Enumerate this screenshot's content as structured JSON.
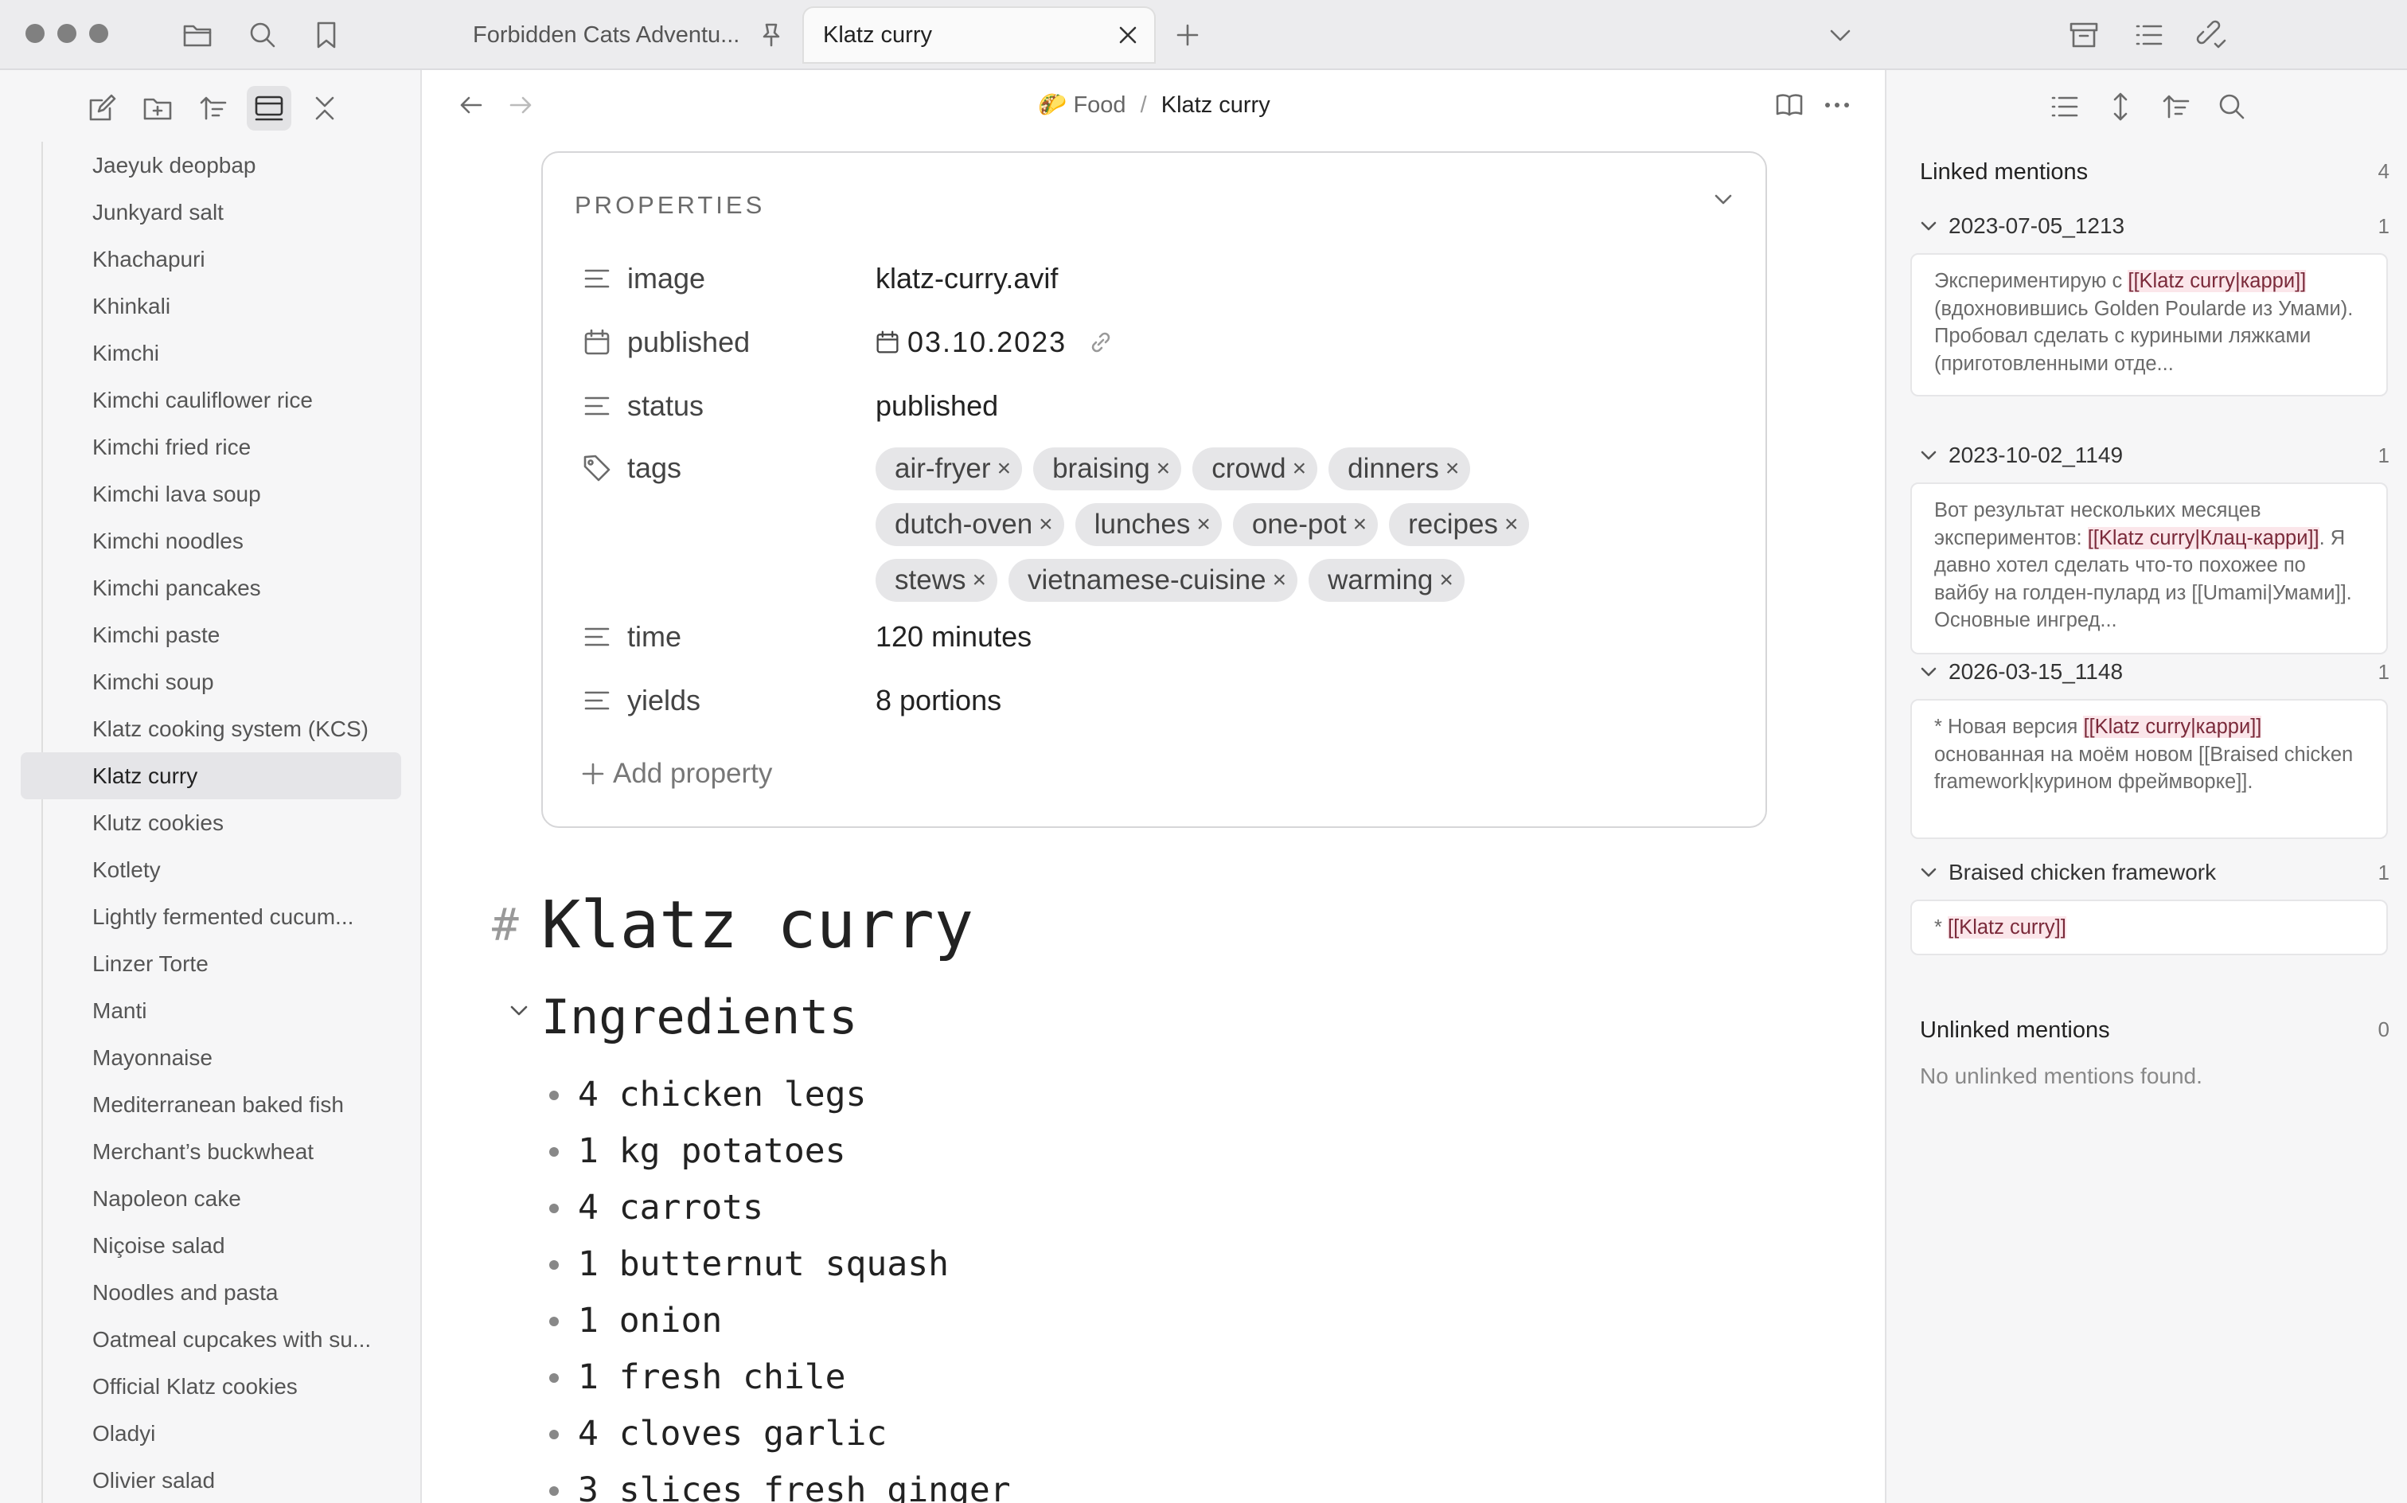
{
  "tabs": [
    {
      "label": "Forbidden Cats Adventu...",
      "active": false
    },
    {
      "label": "Klatz curry",
      "active": true
    }
  ],
  "sidebar": {
    "items": [
      "Jaeyuk deopbap",
      "Junkyard salt",
      "Khachapuri",
      "Khinkali",
      "Kimchi",
      "Kimchi cauliflower rice",
      "Kimchi fried rice",
      "Kimchi lava soup",
      "Kimchi noodles",
      "Kimchi pancakes",
      "Kimchi paste",
      "Kimchi soup",
      "Klatz cooking system (KCS)",
      "Klatz curry",
      "Klutz cookies",
      "Kotlety",
      "Lightly fermented cucum...",
      "Linzer Torte",
      "Manti",
      "Mayonnaise",
      "Mediterranean baked fish",
      "Merchant’s buckwheat",
      "Napoleon cake",
      "Niçoise salad",
      "Noodles and pasta",
      "Oatmeal cupcakes with su...",
      "Official Klatz cookies",
      "Oladyi",
      "Olivier salad"
    ],
    "active_item": "Klatz curry"
  },
  "breadcrumb": {
    "folder_emoji": "🌮",
    "folder": "Food",
    "separator": "/",
    "current": "Klatz curry"
  },
  "properties": {
    "title": "PROPERTIES",
    "image": {
      "key": "image",
      "value": "klatz-curry.avif"
    },
    "published": {
      "key": "published",
      "value": "03.10.2023"
    },
    "status": {
      "key": "status",
      "value": "published"
    },
    "tags": {
      "key": "tags",
      "values": [
        "air-fryer",
        "braising",
        "crowd",
        "dinners",
        "dutch-oven",
        "lunches",
        "one-pot",
        "recipes",
        "stews",
        "vietnamese-cuisine",
        "warming"
      ]
    },
    "time": {
      "key": "time",
      "value": "120 minutes"
    },
    "yields": {
      "key": "yields",
      "value": "8 portions"
    },
    "add_label": "Add property"
  },
  "document": {
    "heading_marker": "#",
    "title": "Klatz curry",
    "section": "Ingredients",
    "ingredients": [
      "4 chicken legs",
      "1 kg potatoes",
      "4 carrots",
      "1 butternut squash",
      "1 onion",
      "1 fresh chile",
      "4 cloves garlic",
      "3 slices fresh ginger"
    ]
  },
  "backlinks": {
    "linked_title": "Linked mentions",
    "linked_count": "4",
    "groups": [
      {
        "name": "2023-07-05_1213",
        "count": "1",
        "pre": "Экспериментирую с ",
        "link": "[[Klatz curry|карри]]",
        "post": " (вдохновившись Golden Poularde из Умами). Пробовал сделать с куриными ляжками (приготовленными отде..."
      },
      {
        "name": "2023-10-02_1149",
        "count": "1",
        "pre": "Вот результат нескольких месяцев экспериментов: ",
        "link": "[[Klatz curry|Клац-карри]]",
        "post": ". Я давно хотел сделать что-то похожее по вайбу на голден-пулард из [[Umami|Умами]]. Основные ингред..."
      },
      {
        "name": "2026-03-15_1148",
        "count": "1",
        "pre": "* Новая версия ",
        "link": "[[Klatz curry|карри]]",
        "post": " основанная на моём новом [[Braised chicken framework|курином фреймворке]]."
      },
      {
        "name": "Braised chicken framework",
        "count": "1",
        "pre": "* ",
        "link": "[[Klatz curry]]",
        "post": ""
      }
    ],
    "unlinked_title": "Unlinked mentions",
    "unlinked_count": "0",
    "unlinked_empty": "No unlinked mentions found."
  }
}
